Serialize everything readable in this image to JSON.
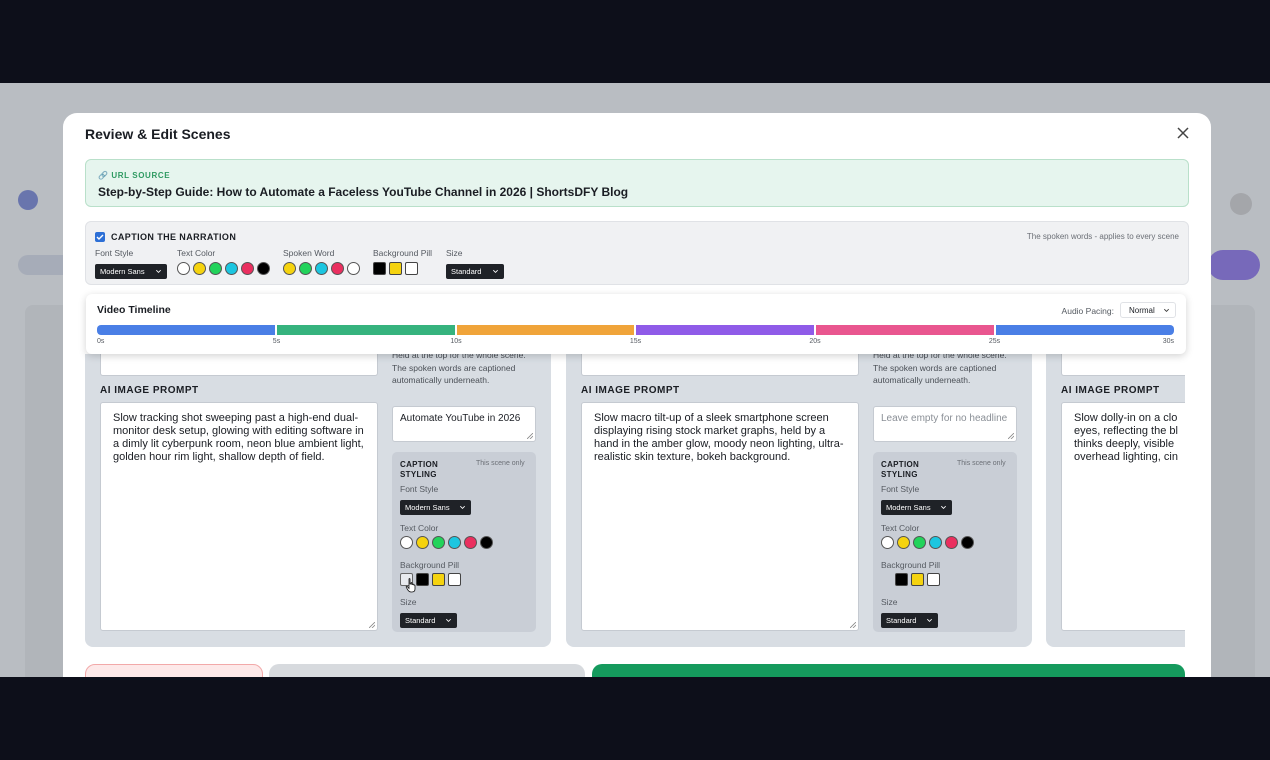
{
  "modal": {
    "title": "Review & Edit Scenes"
  },
  "url_source": {
    "label": "🔗 URL SOURCE",
    "title": "Step-by-Step Guide: How to Automate a Faceless YouTube Channel in 2026 | ShortsDFY Blog"
  },
  "caption": {
    "enabled": true,
    "title": "CAPTION THE NARRATION",
    "note": "The spoken words - applies to every scene",
    "font_style": {
      "label": "Font Style",
      "value": "Modern Sans"
    },
    "text_color": {
      "label": "Text Color",
      "swatches": [
        "#ffffff",
        "#f5d30f",
        "#22d35b",
        "#1cc6e0",
        "#ea2f5f",
        "#000000"
      ]
    },
    "spoken_word": {
      "label": "Spoken Word",
      "swatches": [
        "#f5d30f",
        "#22d35b",
        "#1cc6e0",
        "#ea2f5f",
        "#ffffff"
      ]
    },
    "background_pill": {
      "label": "Background Pill",
      "swatches": [
        "#000000",
        "#f5d30f",
        "#ffffff"
      ]
    },
    "size": {
      "label": "Size",
      "value": "Standard"
    }
  },
  "timeline": {
    "title": "Video Timeline",
    "pacing_label": "Audio Pacing:",
    "pacing_value": "Normal",
    "segments": [
      {
        "color": "#4a7fe6"
      },
      {
        "color": "#36b37e"
      },
      {
        "color": "#f0a43a"
      },
      {
        "color": "#8f5be8"
      },
      {
        "color": "#e9568f"
      },
      {
        "color": "#4a7fe6"
      }
    ],
    "ticks": [
      "0s",
      "5s",
      "10s",
      "15s",
      "20s",
      "25s",
      "30s"
    ]
  },
  "scenes": [
    {
      "note": "Held at the top for the whole scene. The spoken words are captioned automatically underneath.",
      "prompt_label": "AI IMAGE PROMPT",
      "prompt": "Slow tracking shot sweeping past a high-end dual-monitor desk setup, glowing with editing software in a dimly lit cyberpunk room, neon blue ambient light, golden hour rim light, shallow depth of field.",
      "headline": "Automate YouTube in 2026",
      "headline_placeholder": "",
      "styling": {
        "title": "CAPTION STYLING",
        "note": "This scene only",
        "font_label": "Font Style",
        "font_value": "Modern Sans",
        "text_color_label": "Text Color",
        "text_colors": [
          "#ffffff",
          "#f5d30f",
          "#22d35b",
          "#1cc6e0",
          "#ea2f5f",
          "#000000"
        ],
        "pill_label": "Background Pill",
        "pills": [
          "none",
          "#000000",
          "#f5d30f",
          "#ffffff"
        ],
        "size_label": "Size",
        "size_value": "Standard"
      }
    },
    {
      "note": "Held at the top for the whole scene. The spoken words are captioned automatically underneath.",
      "prompt_label": "AI IMAGE PROMPT",
      "prompt": "Slow macro tilt-up of a sleek smartphone screen displaying rising stock market graphs, held by a hand in the amber glow, moody neon lighting, ultra-realistic skin texture, bokeh background.",
      "headline": "",
      "headline_placeholder": "Leave empty for no headline",
      "styling": {
        "title": "CAPTION STYLING",
        "note": "This scene only",
        "font_label": "Font Style",
        "font_value": "Modern Sans",
        "text_color_label": "Text Color",
        "text_colors": [
          "#ffffff",
          "#f5d30f",
          "#22d35b",
          "#1cc6e0",
          "#ea2f5f",
          "#000000"
        ],
        "pill_label": "Background Pill",
        "pills": [
          "#000000",
          "#f5d30f",
          "#ffffff"
        ],
        "size_label": "Size",
        "size_value": "Standard"
      }
    },
    {
      "prompt_label": "AI IMAGE PROMPT",
      "prompt_lines": [
        "Slow dolly-in on a clo",
        "eyes, reflecting the bl",
        "thinks deeply, visible",
        "overhead lighting, cin"
      ]
    }
  ],
  "colors": {
    "accent_blue": "#2d6fd6",
    "success_green": "#159a5d",
    "url_bg": "#e6f5ee",
    "danger_bg": "#fde9e9"
  }
}
